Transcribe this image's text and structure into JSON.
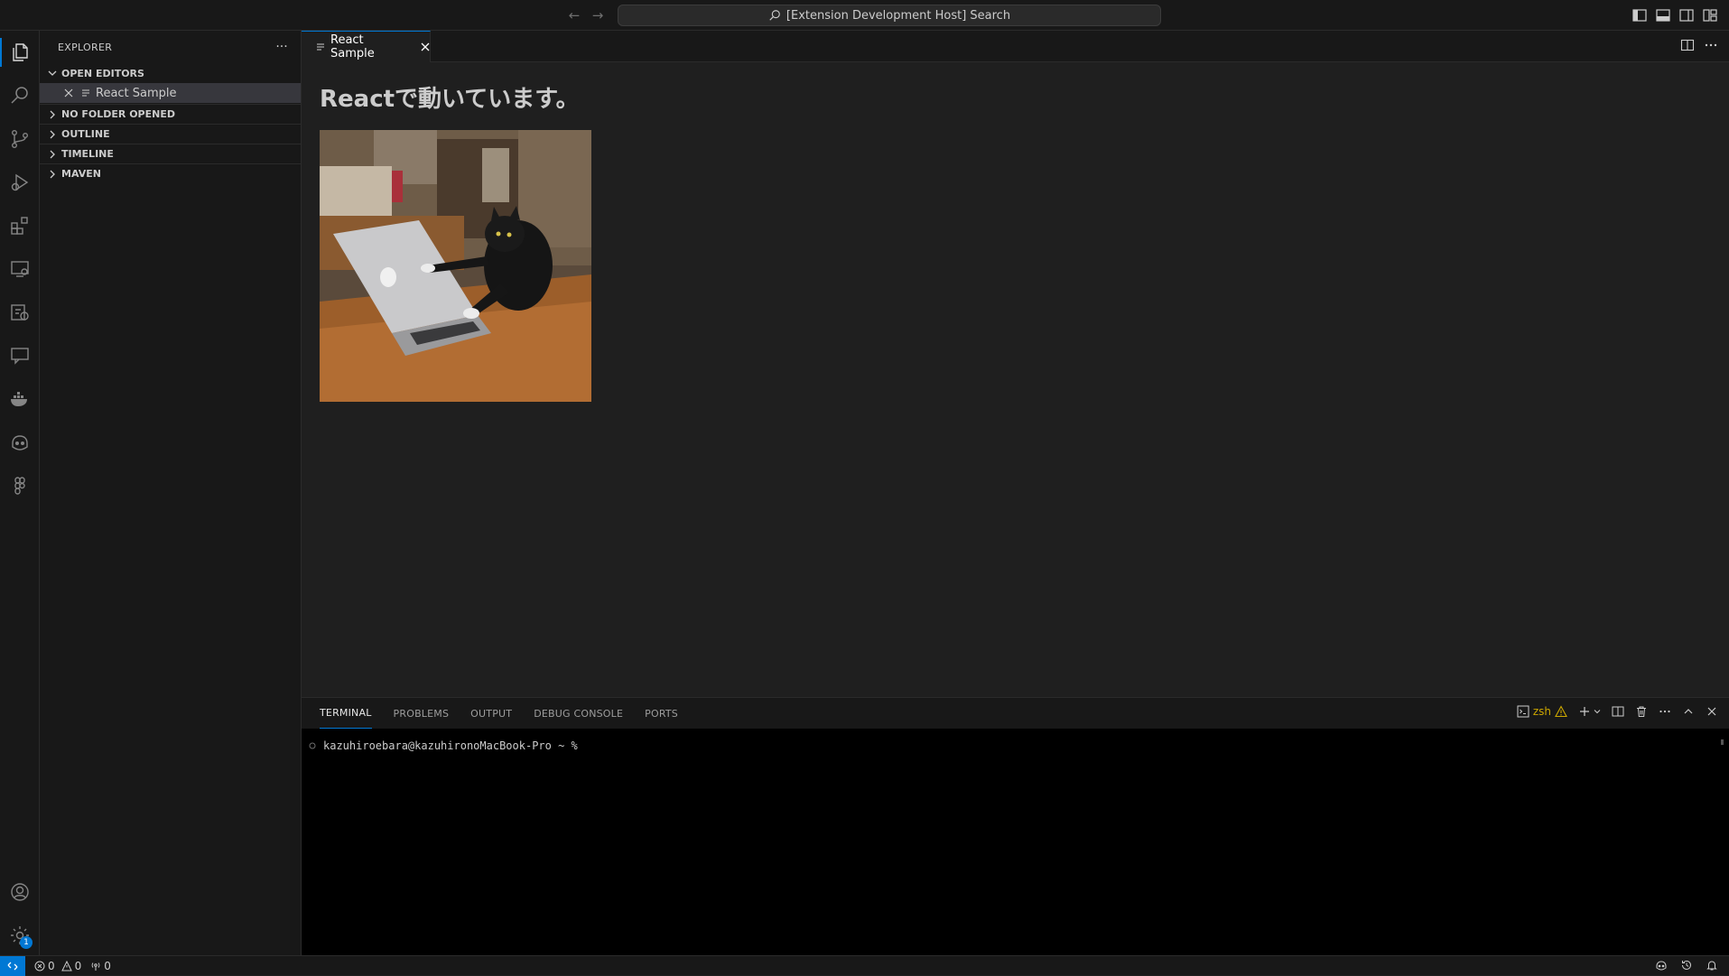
{
  "titlebar": {
    "search_label": "[Extension Development Host] Search",
    "back_glyph": "←",
    "forward_glyph": "→"
  },
  "activitybar": {
    "items": [
      "files-icon",
      "search-icon",
      "source-control-icon",
      "run-debug-icon",
      "extensions-icon",
      "remote-explorer-icon",
      "testing-icon",
      "chat-icon",
      "docker-icon",
      "copilot-icon",
      "figma-icon"
    ],
    "settings_badge": "1"
  },
  "sidebar": {
    "title": "EXPLORER",
    "more_glyph": "···",
    "sections": {
      "open_editors": "OPEN EDITORS",
      "no_folder": "NO FOLDER OPENED",
      "outline": "OUTLINE",
      "timeline": "TIMELINE",
      "maven": "MAVEN"
    },
    "open_editor_item": "React Sample"
  },
  "editor": {
    "tab_label": "React Sample",
    "heading": "Reactで動いています。"
  },
  "panel": {
    "tabs": {
      "terminal": "TERMINAL",
      "problems": "PROBLEMS",
      "output": "OUTPUT",
      "debug_console": "DEBUG CONSOLE",
      "ports": "PORTS"
    },
    "shell_name": "zsh",
    "prompt": "kazuhiroebara@kazuhironoMacBook-Pro ~ %"
  },
  "statusbar": {
    "errors": "0",
    "warnings": "0",
    "ports": "0"
  },
  "colors": {
    "accent": "#0078d4",
    "warning": "#cca700",
    "background": "#1f1f1f",
    "sidebar": "#181818"
  }
}
